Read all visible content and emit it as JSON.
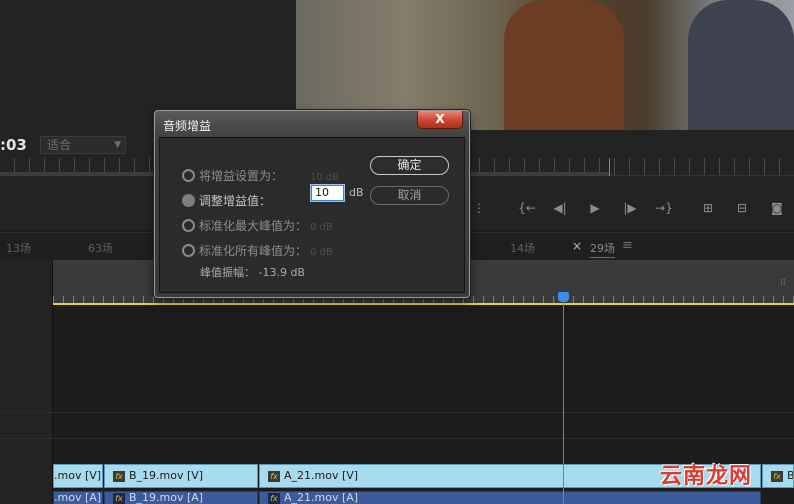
{
  "program_monitor": {
    "timecode": ":03",
    "fit_select": "适合"
  },
  "sequence_tabs": [
    {
      "label": "13场"
    },
    {
      "label": "63场"
    },
    {
      "label": "14场"
    },
    {
      "label": "29场",
      "active": true
    }
  ],
  "tab_close_glyph": "×",
  "tab_menu_glyph": "≡",
  "dialog": {
    "title": "音频增益",
    "close_glyph": "X",
    "options": [
      {
        "label": "将增益设置为：",
        "value": "10 dB",
        "checked": false
      },
      {
        "label": "调整增益值：",
        "value": "10",
        "unit": "dB",
        "checked": true
      },
      {
        "label": "标准化最大峰值为：",
        "value": "0 dB",
        "checked": false
      },
      {
        "label": "标准化所有峰值为：",
        "value": "0 dB",
        "checked": false
      }
    ],
    "peak_amplitude": "峰值振幅：  -13.9 dB",
    "ok_label": "确定",
    "cancel_label": "取消"
  },
  "timeline": {
    "video_clips": [
      {
        "name": ".mov [V]",
        "fx": false
      },
      {
        "name": "B_19.mov [V]",
        "fx": true
      },
      {
        "name": "A_21.mov [V]",
        "fx": true
      },
      {
        "name": "B",
        "fx": true
      }
    ],
    "audio_clips": [
      {
        "name": ".mov [A]",
        "fx": false
      },
      {
        "name": "B_19.mov [A]",
        "fx": true
      },
      {
        "name": "A_21.mov [A]",
        "fx": true
      }
    ],
    "fx_glyph": "fx"
  },
  "watermark": "云南龙网",
  "colors": {
    "playhead": "#3b8df0",
    "work_area": "#e6d42f",
    "video_clip": "#a7dcef",
    "audio_clip": "#3d5b9a",
    "close_button": "#cd4a34"
  },
  "icons": [
    "mark-in-icon",
    "step-back-icon",
    "play-icon",
    "step-forward-icon",
    "mark-out-icon",
    "insert-icon",
    "overwrite-icon",
    "camera-icon"
  ]
}
